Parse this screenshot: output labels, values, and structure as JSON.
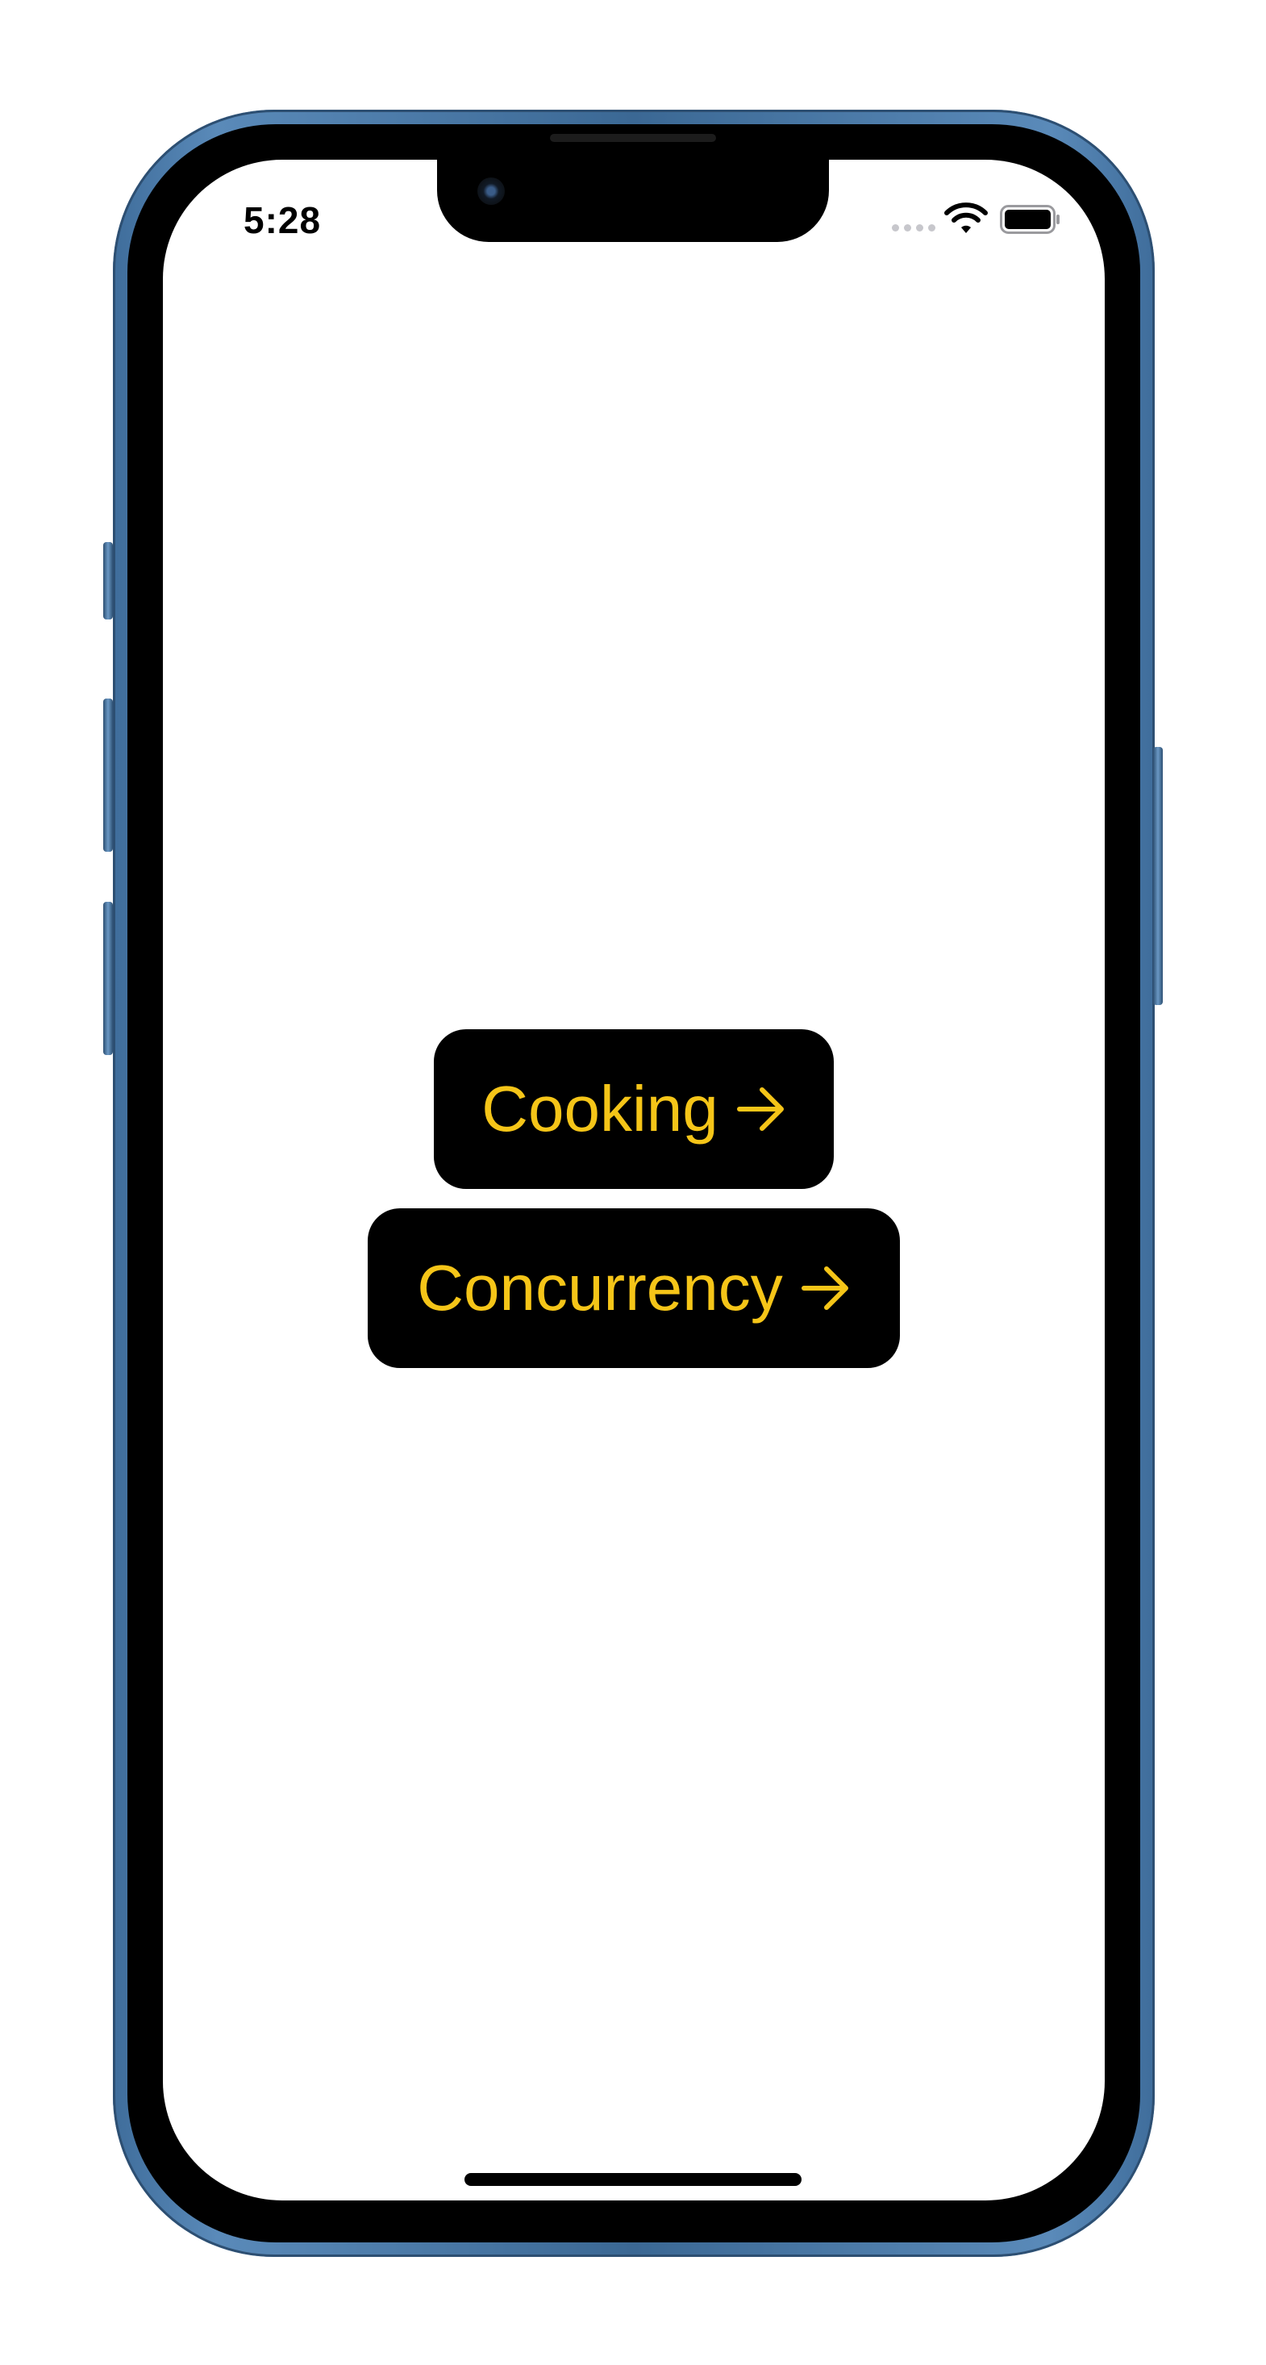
{
  "status_bar": {
    "time": "5:28"
  },
  "icons": {
    "wifi": "wifi-icon",
    "battery": "battery-icon",
    "arrow": "arrow-right-icon"
  },
  "colors": {
    "button_background": "#000000",
    "button_text": "#f5c518",
    "device_frame": "#4a7aab",
    "screen_background": "#ffffff"
  },
  "main": {
    "buttons": [
      {
        "label": "Cooking"
      },
      {
        "label": "Concurrency"
      }
    ]
  }
}
